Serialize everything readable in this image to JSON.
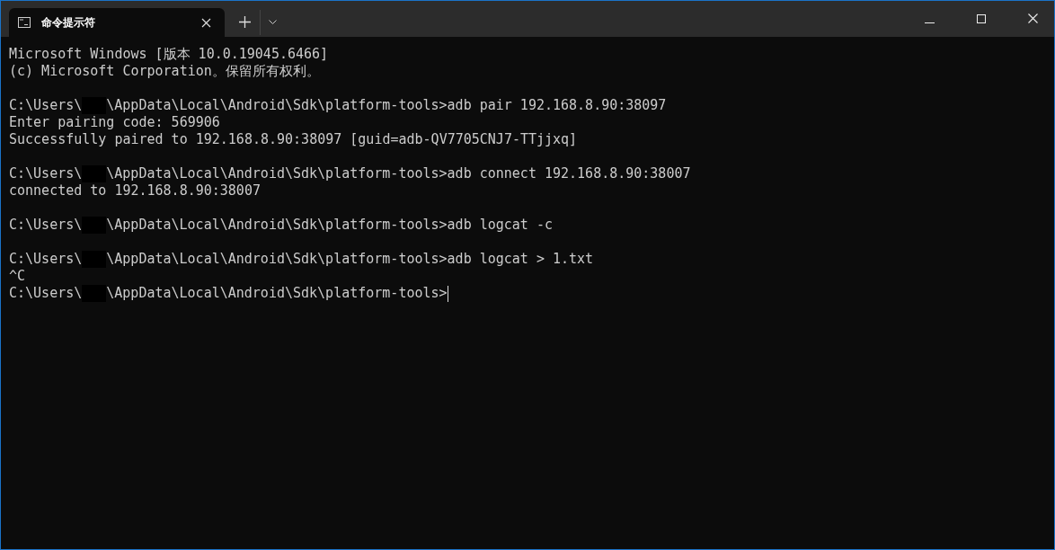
{
  "window": {
    "tab": {
      "title": "命令提示符",
      "selected": true
    }
  },
  "console": {
    "lines": [
      {
        "kind": "text",
        "text": "Microsoft Windows [版本 10.0.19045.6466]"
      },
      {
        "kind": "text",
        "text": "(c) Microsoft Corporation。保留所有权利。"
      },
      {
        "kind": "blank"
      },
      {
        "kind": "prompt",
        "before": "C:\\Users\\",
        "after": "\\AppData\\Local\\Android\\Sdk\\platform-tools>adb pair 192.168.8.90:38097",
        "cursor": false
      },
      {
        "kind": "text",
        "text": "Enter pairing code: 569906"
      },
      {
        "kind": "text",
        "text": "Successfully paired to 192.168.8.90:38097 [guid=adb-QV7705CNJ7-TTjjxq]"
      },
      {
        "kind": "blank"
      },
      {
        "kind": "prompt",
        "before": "C:\\Users\\",
        "after": "\\AppData\\Local\\Android\\Sdk\\platform-tools>adb connect 192.168.8.90:38007",
        "cursor": false
      },
      {
        "kind": "text",
        "text": "connected to 192.168.8.90:38007"
      },
      {
        "kind": "blank"
      },
      {
        "kind": "prompt",
        "before": "C:\\Users\\",
        "after": "\\AppData\\Local\\Android\\Sdk\\platform-tools>adb logcat -c",
        "cursor": false
      },
      {
        "kind": "blank"
      },
      {
        "kind": "prompt",
        "before": "C:\\Users\\",
        "after": "\\AppData\\Local\\Android\\Sdk\\platform-tools>adb logcat > 1.txt",
        "cursor": false
      },
      {
        "kind": "text",
        "text": "^C"
      },
      {
        "kind": "prompt",
        "before": "C:\\Users\\",
        "after": "\\AppData\\Local\\Android\\Sdk\\platform-tools>",
        "cursor": true
      }
    ]
  }
}
